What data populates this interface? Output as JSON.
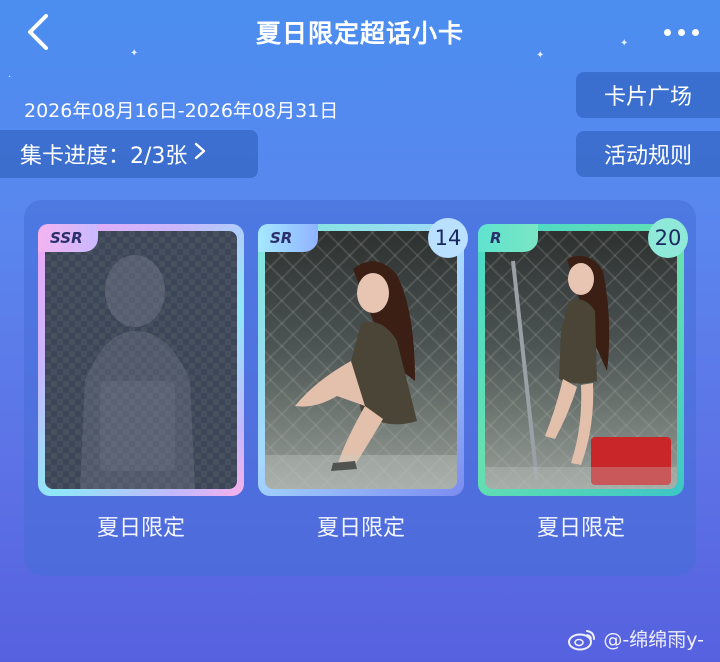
{
  "header": {
    "title": "夏日限定超话小卡"
  },
  "event": {
    "date_range": "2026年08月16日-2026年08月31日",
    "progress_label": "集卡进度：2/3张",
    "card_square_label": "卡片广场",
    "rules_label": "活动规则"
  },
  "cards": [
    {
      "rarity": "SSR",
      "label": "夏日限定",
      "count": null,
      "locked": true
    },
    {
      "rarity": "SR",
      "label": "夏日限定",
      "count": "14",
      "locked": false
    },
    {
      "rarity": "R",
      "label": "夏日限定",
      "count": "20",
      "locked": false
    }
  ],
  "watermark": {
    "text": "@-绵绵雨y-"
  },
  "colors": {
    "accent": "#5a86ee",
    "pill": "#2f5ab4"
  }
}
